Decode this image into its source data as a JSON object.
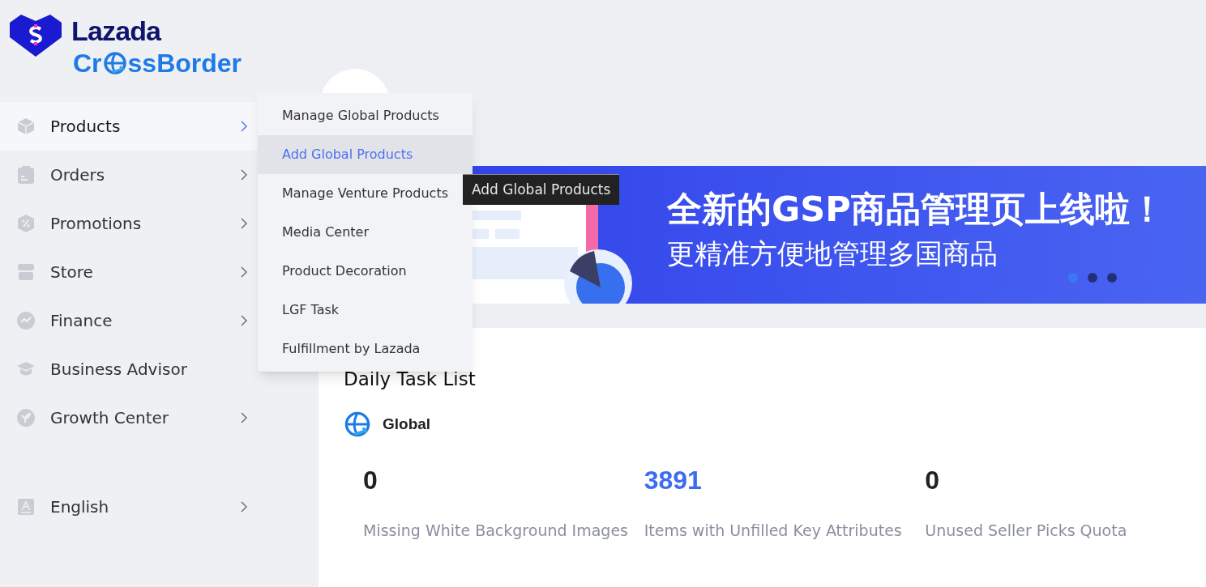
{
  "logo": {
    "brand": "Lazada",
    "sub_before": "Cr",
    "sub_after": "ssBorder"
  },
  "sidebar": {
    "items": [
      {
        "kind": "box",
        "label": "Products",
        "has_submenu": true,
        "expanded": true
      },
      {
        "kind": "clipboard",
        "label": "Orders",
        "has_submenu": true,
        "expanded": false
      },
      {
        "kind": "percent",
        "label": "Promotions",
        "has_submenu": true,
        "expanded": false
      },
      {
        "kind": "store",
        "label": "Store",
        "has_submenu": true,
        "expanded": false
      },
      {
        "kind": "chart",
        "label": "Finance",
        "has_submenu": true,
        "expanded": false
      },
      {
        "kind": "cap",
        "label": "Business Advisor",
        "has_submenu": false,
        "expanded": false
      },
      {
        "kind": "rocket",
        "label": "Growth Center",
        "has_submenu": true,
        "expanded": false
      }
    ],
    "language": {
      "label": "English",
      "has_submenu": true
    }
  },
  "submenu": {
    "items": [
      {
        "label": "Manage Global Products",
        "selected": false
      },
      {
        "label": "Add Global Products",
        "selected": true
      },
      {
        "label": "Manage Venture Products",
        "selected": false
      },
      {
        "label": "Media Center",
        "selected": false
      },
      {
        "label": "Product Decoration",
        "selected": false
      },
      {
        "label": "LGF Task",
        "selected": false
      },
      {
        "label": "Fulfillment by Lazada",
        "selected": false
      }
    ]
  },
  "tooltip": {
    "text": "Add Global Products"
  },
  "banner": {
    "headline": "全新的GSP商品管理页上线啦！",
    "subline": "更精准方便地管理多国商品",
    "dots": [
      {
        "selected": true
      },
      {
        "selected": false
      },
      {
        "selected": false
      }
    ]
  },
  "task_list": {
    "title": "Daily Task List",
    "region": "Global",
    "stats": [
      {
        "value": "0",
        "label": "Missing White Background Images",
        "highlighted": false
      },
      {
        "value": "3891",
        "label": "Items with Unfilled Key Attributes",
        "highlighted": true
      },
      {
        "value": "0",
        "label": "Unused Seller Picks Quota",
        "highlighted": false
      }
    ]
  }
}
